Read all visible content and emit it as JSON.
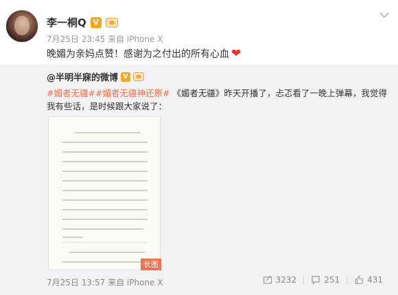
{
  "post": {
    "username": "李一桐Q",
    "verified_badge": "V",
    "meta": "7月25日 23:45 来自 iPhone X",
    "text": "晚媚为亲妈点赞！感谢为之付出的所有心血",
    "icons": {
      "avatar": "avatar",
      "verified": "verified-v-icon",
      "vip": "vip-icon",
      "menu": "chevron-down-icon",
      "heart": "heart-icon"
    }
  },
  "repost": {
    "author": "@半明半寐的微博",
    "verified_badge": "V",
    "tag1": "#媚者无疆#",
    "tag2": "#媚者无疆神还原#",
    "text": " 《媚者无疆》昨天开播了，忐忑看了一晚上弹幕，我觉得我有些话，是时候跟大家说了：",
    "long_image_badge": "长图",
    "meta": "7月25日 13:57 来自 iPhone X",
    "stats": {
      "reposts": "3232",
      "comments": "251",
      "likes": "431"
    },
    "icons": {
      "repost": "repost-icon",
      "comment": "comment-icon",
      "like": "like-icon"
    }
  },
  "colors": {
    "accent_orange": "#eb7350",
    "badge_gold": "#f5a623",
    "heart_red": "#e8332b",
    "repost_bg": "#f2f2f5"
  }
}
